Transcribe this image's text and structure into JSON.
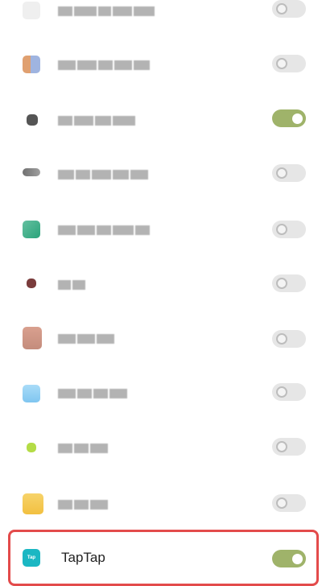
{
  "screen": {
    "title": "",
    "apps": [
      {
        "id": "app-1",
        "name": "",
        "enabled": false,
        "icon_color": "#e9e9e9"
      },
      {
        "id": "app-2",
        "name": "",
        "enabled": false,
        "icon_color": "#e0a070"
      },
      {
        "id": "app-3",
        "name": "",
        "enabled": true,
        "icon_color": "#555555"
      },
      {
        "id": "app-4",
        "name": "",
        "enabled": false,
        "icon_color": "#707070"
      },
      {
        "id": "app-5",
        "name": "",
        "enabled": false,
        "icon_color": "#64c0a0"
      },
      {
        "id": "app-6",
        "name": "",
        "enabled": false,
        "icon_color": "#7a3c3c"
      },
      {
        "id": "app-7",
        "name": "",
        "enabled": false,
        "icon_color": "#c48c7c"
      },
      {
        "id": "app-8",
        "name": "",
        "enabled": false,
        "icon_color": "#7fc6f0"
      },
      {
        "id": "app-9",
        "name": "",
        "enabled": false,
        "icon_color": "#b4dc46"
      },
      {
        "id": "app-10",
        "name": "",
        "enabled": false,
        "icon_color": "#f2c040"
      },
      {
        "id": "app-11",
        "name": "TapTap",
        "enabled": true,
        "icon_color": "#1bb7c3",
        "icon_text": "Tap"
      }
    ],
    "colors": {
      "toggle_on": "#9fb36a",
      "toggle_off": "#e6e6e6",
      "highlight": "#e34b4b"
    }
  }
}
